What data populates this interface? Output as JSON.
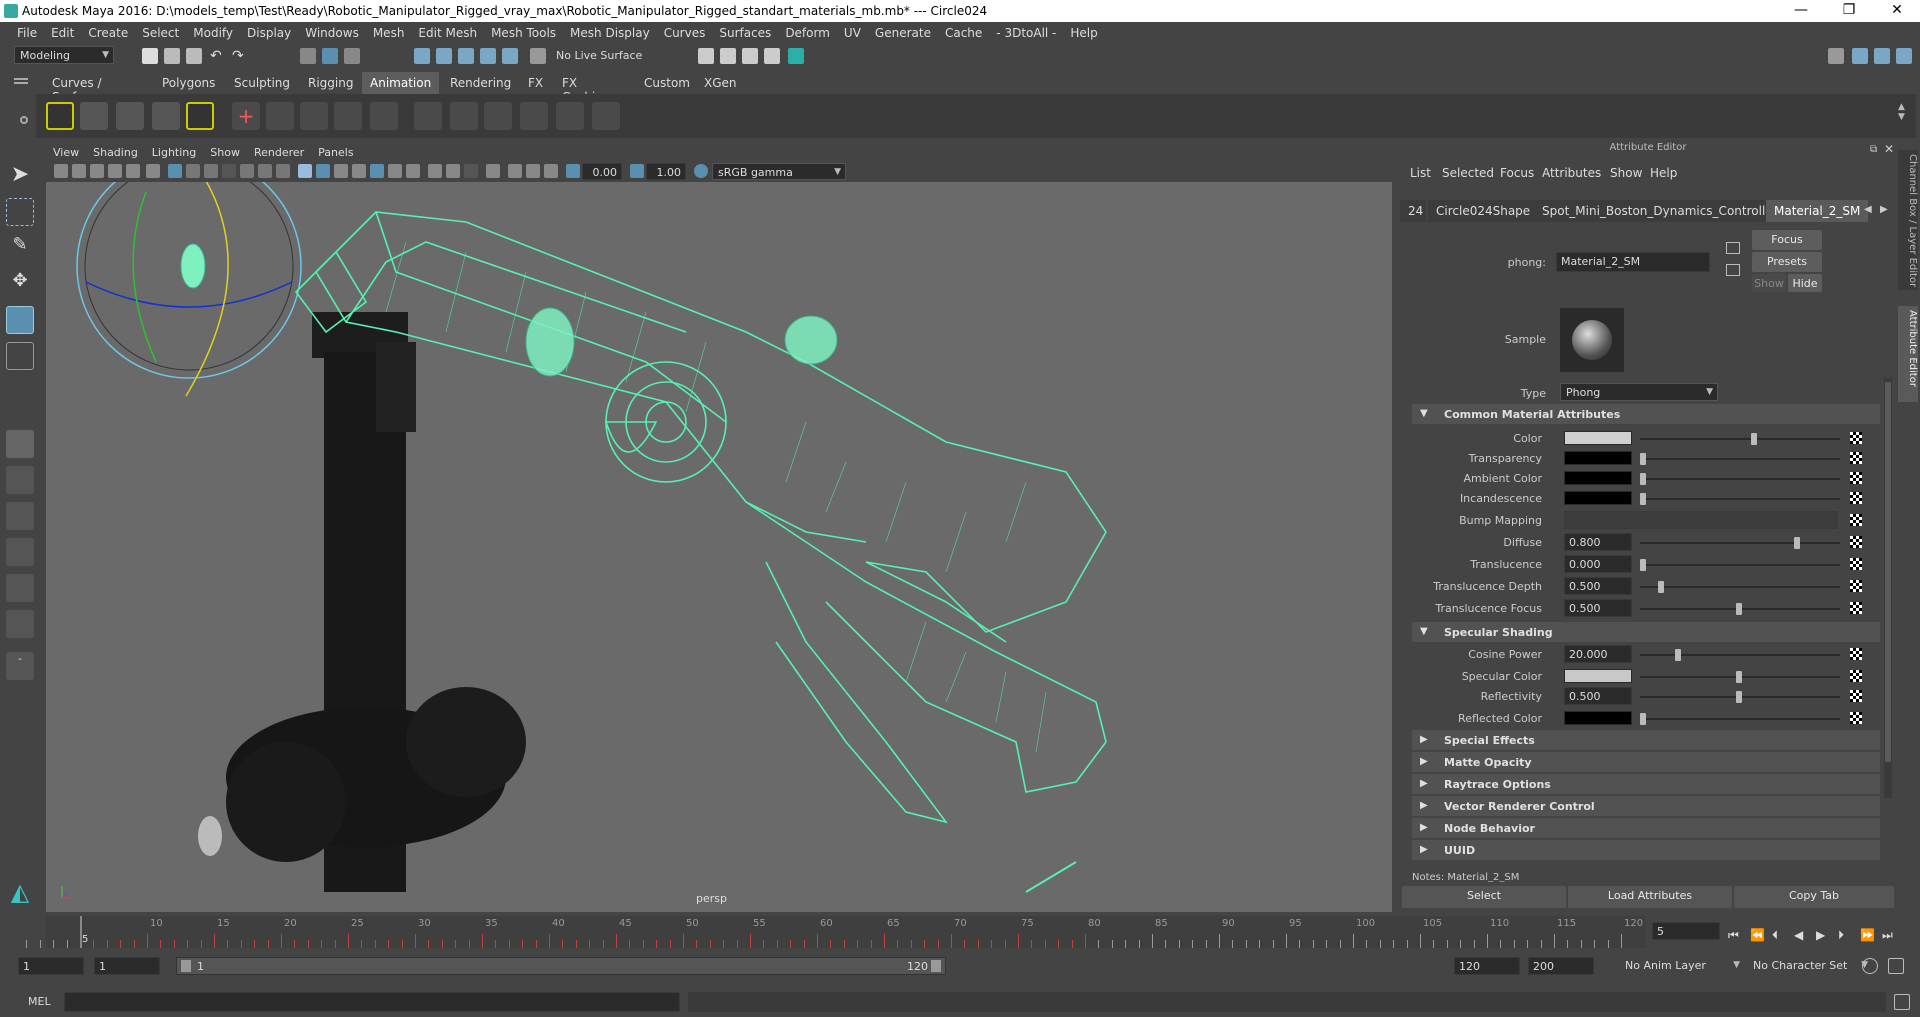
{
  "window": {
    "title": "Autodesk Maya 2016: D:\\models_temp\\Test\\Ready\\Robotic_Manipulator_Rigged_vray_max\\Robotic_Manipulator_Rigged_standart_materials_mb.mb*   ---   Circle024",
    "controls": {
      "minimize": "—",
      "restore": "❐",
      "close": "✕"
    }
  },
  "menubar": [
    "File",
    "Edit",
    "Create",
    "Select",
    "Modify",
    "Display",
    "Windows",
    "Mesh",
    "Edit Mesh",
    "Mesh Tools",
    "Mesh Display",
    "Curves",
    "Surfaces",
    "Deform",
    "UV",
    "Generate",
    "Cache",
    "- 3DtoAll -",
    "Help"
  ],
  "statusline": {
    "menuset": "Modeling",
    "live_surface": "No Live Surface"
  },
  "shelf": {
    "tabs": [
      "Curves / Surfaces",
      "Polygons",
      "Sculpting",
      "Rigging",
      "Animation",
      "Rendering",
      "FX",
      "FX Caching",
      "Custom",
      "XGen"
    ],
    "active_tab": "Animation"
  },
  "viewport": {
    "menus": [
      "View",
      "Shading",
      "Lighting",
      "Show",
      "Renderer",
      "Panels"
    ],
    "exposure": "0.00",
    "gamma": "1.00",
    "color_space": "sRGB gamma",
    "camera_label": "persp",
    "colors": {
      "wire": "#57f0b0",
      "mesh": "#1b1b1b",
      "bg": "#6a6a6a"
    }
  },
  "attribute_editor": {
    "header": "Attribute Editor",
    "menus": [
      "List",
      "Selected",
      "Focus",
      "Attributes",
      "Show",
      "Help"
    ],
    "tabs": [
      "24",
      "Circle024Shape",
      "Spot_Mini_Boston_Dynamics_Controllers",
      "Material_2_SM"
    ],
    "active_tab": "Material_2_SM",
    "node_type_label": "phong:",
    "node_name": "Material_2_SM",
    "buttons": {
      "focus": "Focus",
      "presets": "Presets",
      "show": "Show",
      "hide": "Hide"
    },
    "sample_label": "Sample",
    "type_label": "Type",
    "type_value": "Phong",
    "sections": {
      "common": "Common Material Attributes",
      "specular": "Specular Shading",
      "collapsed": [
        "Special Effects",
        "Matte Opacity",
        "Raytrace Options",
        "Vector Renderer Control",
        "Node Behavior",
        "UUID"
      ]
    },
    "common_attrs": {
      "color": "Color",
      "transparency": "Transparency",
      "ambient": "Ambient Color",
      "incandescence": "Incandescence",
      "bump": "Bump Mapping",
      "diffuse": "Diffuse",
      "diffuse_value": "0.800",
      "translucence": "Translucence",
      "translucence_value": "0.000",
      "translucence_depth": "Translucence Depth",
      "translucence_depth_value": "0.500",
      "translucence_focus": "Translucence Focus",
      "translucence_focus_value": "0.500"
    },
    "specular_attrs": {
      "cosine_power": "Cosine Power",
      "cosine_power_value": "20.000",
      "specular_color": "Specular Color",
      "reflectivity": "Reflectivity",
      "reflectivity_value": "0.500",
      "reflected_color": "Reflected Color"
    },
    "notes": "Notes: Material_2_SM",
    "bottom_buttons": [
      "Select",
      "Load Attributes",
      "Copy Tab"
    ]
  },
  "side_tabs": {
    "channel_box": "Channel Box / Layer Editor",
    "attribute_editor": "Attribute Editor"
  },
  "timeline": {
    "labels": [
      "5",
      "10",
      "15",
      "20",
      "25",
      "30",
      "35",
      "40",
      "45",
      "50",
      "55",
      "60",
      "65",
      "70",
      "75",
      "80",
      "85",
      "90",
      "95",
      "100",
      "105",
      "110",
      "115",
      "120"
    ],
    "current_frame": "5",
    "current_field": "5"
  },
  "range": {
    "start": "1",
    "anim_start": "1",
    "slider_start": "1",
    "slider_end": "120",
    "playback_end": "120",
    "anim_end": "200",
    "anim_layer": "No Anim Layer",
    "character_set": "No Character Set"
  },
  "cmdline": {
    "lang": "MEL"
  }
}
